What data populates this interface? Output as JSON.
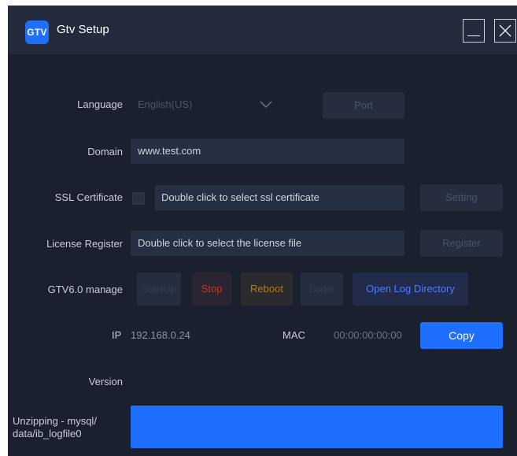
{
  "window": {
    "logo_text": "GTV",
    "title": "Gtv Setup"
  },
  "language": {
    "label": "Language",
    "selected": "English(US)",
    "port_button": "Port"
  },
  "domain": {
    "label": "Domain",
    "value": "www.test.com"
  },
  "ssl": {
    "label": "SSL Certificate",
    "placeholder": "Double click to select ssl certificate",
    "setting_button": "Setting"
  },
  "license": {
    "label": "License Register",
    "placeholder": "Double click to select the license file",
    "register_button": "Register"
  },
  "manage": {
    "label": "GTV6.0 manage",
    "startup_button": "StartUp",
    "stop_button": "Stop",
    "reboot_button": "Reboot",
    "login_button": "Login",
    "open_log_button": "Open Log Directory"
  },
  "network": {
    "ip_label": "IP",
    "ip_value": "192.168.0.24",
    "mac_label": "MAC",
    "mac_value": "00:00:00:00:00",
    "copy_button": "Copy"
  },
  "version": {
    "label": "Version",
    "value": ""
  },
  "progress": {
    "label": "Unzipping - mysql/ data/ib_logfile0",
    "fraction": 1.0
  },
  "colors": {
    "background": "#1b202f",
    "titlebar": "#242b3c",
    "accent": "#1f6fff",
    "stop_text": "#c0392b",
    "reboot_text": "#b07a1e",
    "open_log_text": "#4d7cff"
  }
}
